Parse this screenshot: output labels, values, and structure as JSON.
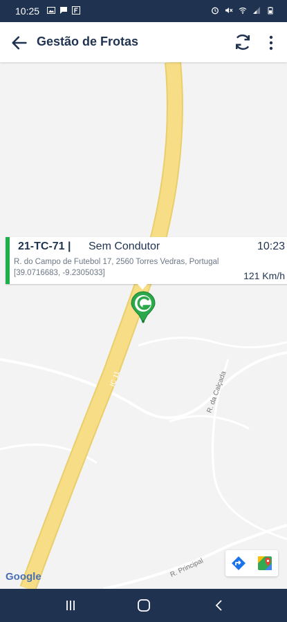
{
  "status_bar": {
    "time": "10:25",
    "left_icons": [
      "image-icon",
      "message-icon",
      "app-f-icon"
    ],
    "right_icons": [
      "alarm-icon",
      "mute-icon",
      "wifi-icon",
      "signal-icon",
      "battery-icon"
    ]
  },
  "app_bar": {
    "title": "Gestão de Frotas",
    "back_icon": "arrow-left-icon",
    "refresh_icon": "refresh-icon",
    "more_icon": "more-vert-icon"
  },
  "vehicle_card": {
    "plate": "21-TC-71 |",
    "driver": "Sem Condutor",
    "time": "10:23",
    "address": "R. do Campo de Futebol 17, 2560 Torres Vedras, Portugal",
    "coordinates": "[39.0716683, -9.2305033]",
    "speed": "121 Km/h",
    "accent_color": "#1fae4b"
  },
  "map": {
    "road_label": "IC 11",
    "street_labels": [
      "R. da Calçada",
      "R. Principal"
    ],
    "attribution": "Google",
    "road_color": "#f6dd86",
    "marker_color": "#2aa84a"
  },
  "nav_bar": {
    "icons": [
      "recent-apps-icon",
      "home-icon",
      "back-nav-icon"
    ]
  },
  "colors": {
    "header": "#1f3350",
    "accent": "#1fae4b"
  }
}
